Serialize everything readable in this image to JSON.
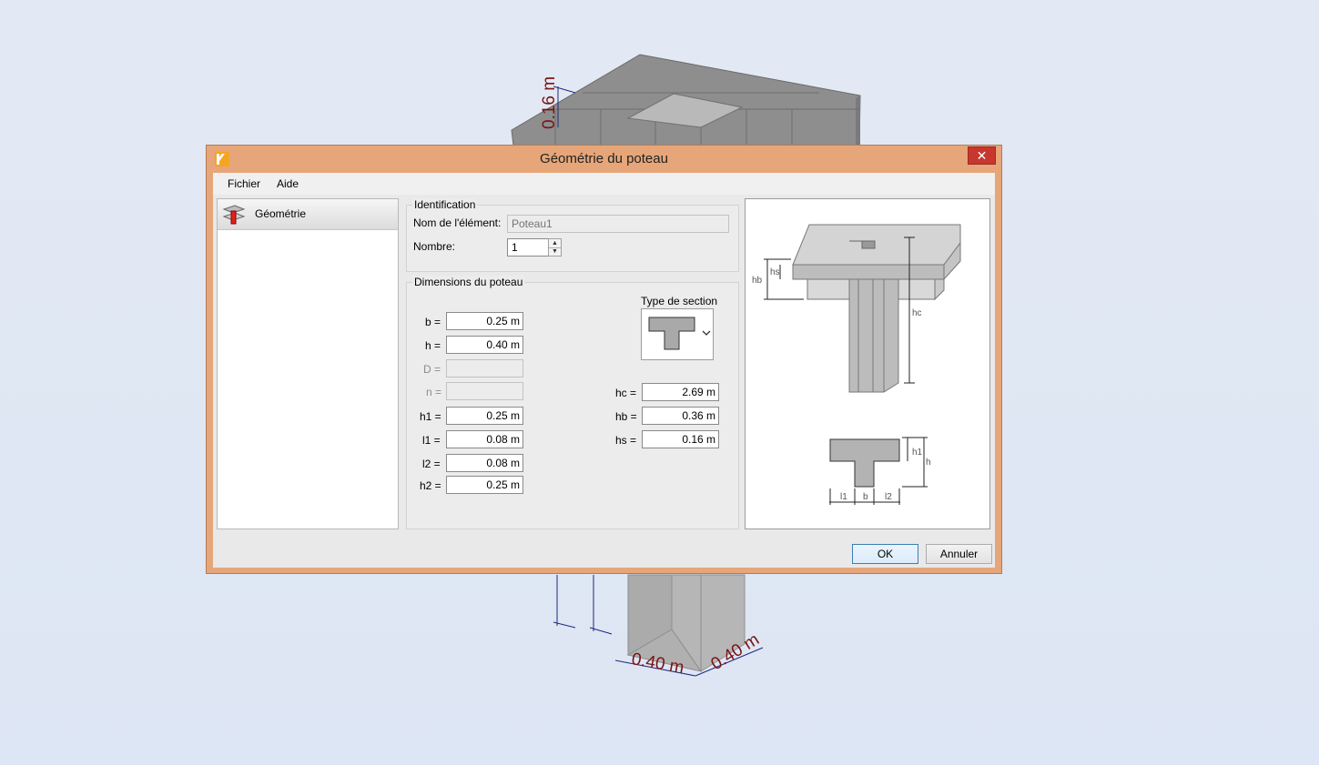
{
  "scene": {
    "dim_slab_thickness": "0.16 m",
    "dim_col_width_1": "0.40 m",
    "dim_col_width_2": "0.40 m"
  },
  "dialog": {
    "title": "Géométrie du poteau",
    "close_label": "✕",
    "menu": {
      "file": "Fichier",
      "help": "Aide"
    },
    "nav": {
      "geometry": "Géométrie"
    },
    "identification": {
      "group_title": "Identification",
      "name_label": "Nom de l'élément:",
      "name_placeholder": "Poteau1",
      "count_label": "Nombre:",
      "count_value": "1"
    },
    "dimensions": {
      "group_title": "Dimensions du poteau",
      "section_type_label": "Type de section",
      "fields": [
        {
          "label": "b =",
          "value": "0.25 m",
          "enabled": true
        },
        {
          "label": "h =",
          "value": "0.40 m",
          "enabled": true
        },
        {
          "label": "D =",
          "value": "",
          "enabled": false
        },
        {
          "label": "n =",
          "value": "",
          "enabled": false
        },
        {
          "label": "h1 =",
          "value": "0.25 m",
          "enabled": true
        },
        {
          "label": "l1 =",
          "value": "0.08 m",
          "enabled": true
        },
        {
          "label": "l2 =",
          "value": "0.08 m",
          "enabled": true
        },
        {
          "label": "h2 =",
          "value": "0.25 m",
          "enabled": true
        }
      ],
      "right_fields": [
        {
          "label": "hc =",
          "value": "2.69 m"
        },
        {
          "label": "hb =",
          "value": "0.36 m"
        },
        {
          "label": "hs =",
          "value": "0.16 m"
        }
      ]
    },
    "diagram_labels": {
      "hs": "hs",
      "hb": "hb",
      "hc": "hc",
      "h1": "h1",
      "h": "h",
      "l1": "l1",
      "b": "b",
      "l2": "l2"
    },
    "buttons": {
      "ok": "OK",
      "cancel": "Annuler"
    }
  }
}
